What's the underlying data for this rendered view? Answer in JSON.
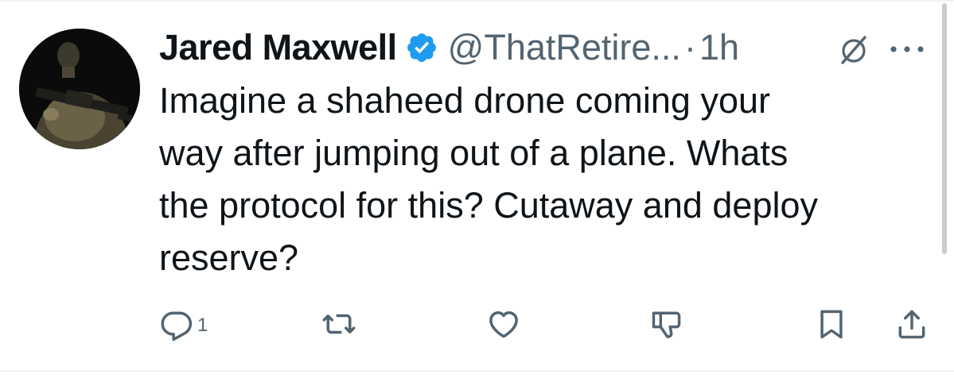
{
  "tweet": {
    "author_name": "Jared Maxwell",
    "handle": "@ThatRetire...",
    "separator": "·",
    "time": "1h",
    "text": "Imagine a shaheed drone coming your\nway after jumping out of a plane. Whats\nthe protocol for this? Cutaway and deploy\nreserve?",
    "verified": true
  },
  "actions": {
    "reply_count": "1",
    "icons": [
      "reply-icon",
      "retweet-icon",
      "like-icon",
      "dislike-icon",
      "bookmark-icon",
      "share-icon"
    ]
  },
  "colors": {
    "text": "#0f1419",
    "secondary": "#536471",
    "verified_badge": "#1d9bf0"
  }
}
